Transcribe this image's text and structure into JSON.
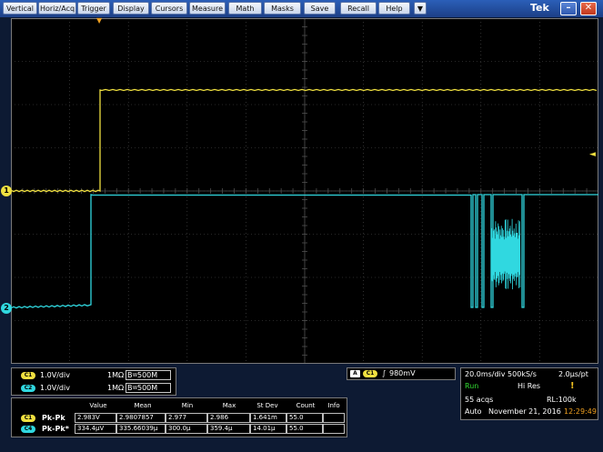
{
  "menu": {
    "items": [
      "Vertical",
      "Horiz/Acq",
      "Trigger",
      "Display",
      "Cursors",
      "Measure",
      "Math",
      "Masks",
      "Save",
      "Recall",
      "Help"
    ],
    "dropdown_glyph": "▼",
    "brand": "Tek",
    "min_glyph": "–",
    "close_glyph": "✕"
  },
  "markers": {
    "trigger_pos": "▼",
    "trigger_level": "◄",
    "ch1": "1",
    "ch2": "2"
  },
  "colors": {
    "ch1": "#f0e040",
    "ch2": "#30d8e0",
    "grid": "#505050",
    "bg": "#000000"
  },
  "channels": [
    {
      "badge": "C1",
      "vdiv": "1.0V/div",
      "impedance": "1MΩ",
      "bw": "500M"
    },
    {
      "badge": "C2",
      "vdiv": "1.0V/div",
      "impedance": "1MΩ",
      "bw": "500M"
    }
  ],
  "bw_prefix": "B",
  "bw_sub": "W",
  "trigger": {
    "mode_badge": "A",
    "source_badge": "C1",
    "slope_glyph": "∫",
    "level": "980mV"
  },
  "measurements": {
    "headers": [
      "Value",
      "Mean",
      "Min",
      "Max",
      "St Dev",
      "Count",
      "Info"
    ],
    "rows": [
      {
        "badge": "C1",
        "name": "Pk-Pk",
        "value": "2.983V",
        "mean": "2.9807857",
        "min": "2.977",
        "max": "2.986",
        "stdev": "1.641m",
        "count": "55.0",
        "info": ""
      },
      {
        "badge": "C4",
        "name": "Pk-Pk*",
        "value": "334.4µV",
        "mean": "335.66039µ",
        "min": "300.0µ",
        "max": "359.4µ",
        "stdev": "14.01µ",
        "count": "55.0",
        "info": ""
      }
    ]
  },
  "acq": {
    "timebase": "20.0ms/div 500kS/s",
    "resolution": "2.0µs/pt",
    "state": "Run",
    "mode": "Hi Res",
    "acqs": "55 acqs",
    "record_length": "RL:100k",
    "trigger_mode": "Auto",
    "date": "November 21, 2016",
    "time": "12:29:49",
    "marker_glyph": "!"
  }
}
